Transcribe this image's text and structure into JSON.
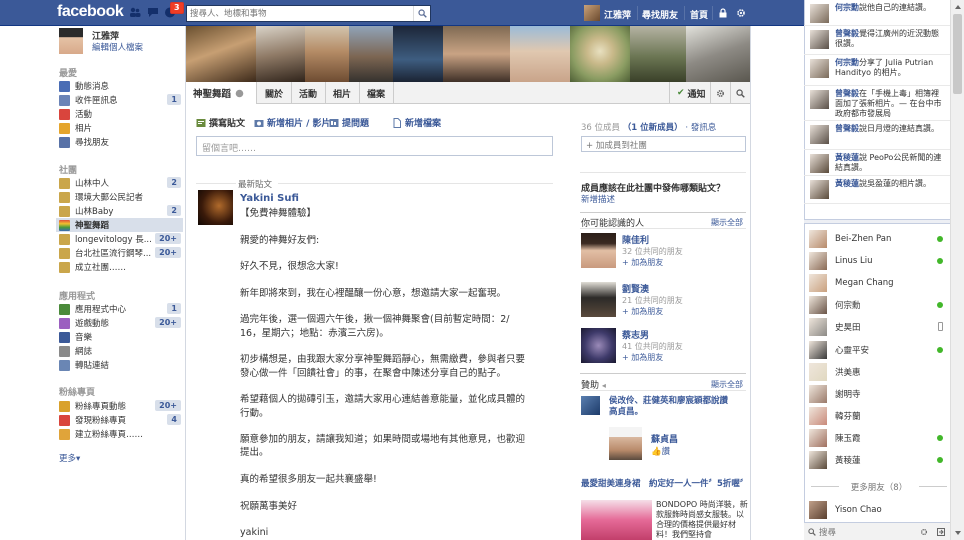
{
  "topbar": {
    "logo": "facebook",
    "notification_count": "3",
    "search_placeholder": "搜尋人、地標和事物",
    "user_name": "江雅萍",
    "find_friends": "尋找朋友",
    "home": "首頁"
  },
  "left_nav": {
    "profile_name": "江雅萍",
    "edit_profile": "編輯個人檔案",
    "favorites_heading": "最愛",
    "favorites": [
      {
        "label": "動態消息",
        "count": "",
        "icon": "news-feed-icon",
        "color": "#4a6db5"
      },
      {
        "label": "收件匣訊息",
        "count": "1",
        "icon": "messages-icon",
        "color": "#6b84b7"
      },
      {
        "label": "活動",
        "count": "",
        "icon": "events-icon",
        "color": "#d9453d"
      },
      {
        "label": "相片",
        "count": "",
        "icon": "photos-icon",
        "color": "#e5a52c"
      },
      {
        "label": "尋找朋友",
        "count": "",
        "icon": "find-friends-icon",
        "color": "#5872a7"
      }
    ],
    "groups_heading": "社團",
    "groups": [
      {
        "label": "山林中人",
        "count": "2",
        "icon": "group-icon",
        "color": "#caa64b"
      },
      {
        "label": "環境大郵公民記者",
        "count": "",
        "icon": "group-icon",
        "color": "#caa64b"
      },
      {
        "label": "山林Baby",
        "count": "2",
        "icon": "group-icon",
        "color": "#caa64b"
      },
      {
        "label": "神聖舞蹈",
        "count": "",
        "icon": "rainbow-group-icon",
        "color": "#e0503a"
      },
      {
        "label": "longevitology 長...",
        "count": "20+",
        "icon": "group-icon",
        "color": "#caa64b"
      },
      {
        "label": "台北社區流行鋼琴...",
        "count": "20+",
        "icon": "group-icon",
        "color": "#caa64b"
      },
      {
        "label": "成立社團……",
        "count": "",
        "icon": "create-group-icon",
        "color": "#caa64b"
      }
    ],
    "apps_heading": "應用程式",
    "apps": [
      {
        "label": "應用程式中心",
        "count": "1",
        "icon": "app-center-icon",
        "color": "#4a8a3a"
      },
      {
        "label": "遊戲動態",
        "count": "20+",
        "icon": "games-icon",
        "color": "#9b5fc0"
      },
      {
        "label": "音樂",
        "count": "",
        "icon": "music-icon",
        "color": "#3b5998"
      },
      {
        "label": "網誌",
        "count": "",
        "icon": "notes-icon",
        "color": "#8a8a8a"
      },
      {
        "label": "轉貼連結",
        "count": "",
        "icon": "links-icon",
        "color": "#6a86b4"
      }
    ],
    "pages_heading": "粉絲專頁",
    "pages": [
      {
        "label": "粉絲專頁動態",
        "count": "20+",
        "icon": "pages-feed-icon",
        "color": "#d9a12b"
      },
      {
        "label": "發現粉絲專頁",
        "count": "4",
        "icon": "discover-pages-icon",
        "color": "#d9453d"
      },
      {
        "label": "建立粉絲專頁……",
        "count": "",
        "icon": "create-page-icon",
        "color": "#e0a43a"
      }
    ],
    "more": "更多▾"
  },
  "group": {
    "name": "神聖舞蹈",
    "tabs": [
      "關於",
      "活動",
      "相片",
      "檔案"
    ],
    "notify": "通知"
  },
  "composer": {
    "tabs": [
      "撰寫貼文",
      "新增相片 / 影片",
      "提問題",
      "新增檔案"
    ],
    "placeholder": "留個言吧……"
  },
  "feed": {
    "label": "最新貼文",
    "author": "Yakini Sufi",
    "lines": [
      "【免費神舞體驗】",
      "",
      "親愛的神舞好友們:",
      "",
      "好久不見，很想念大家!",
      "",
      "新年即將來到，我在心裡醞釀一份心意，想邀請大家一起奮現。",
      "",
      "過完年後，選一個週六午後，揪一個神舞聚會(目前暫定時間：2/",
      "16，星期六；地點：赤濱三六房)。",
      "",
      "初步構想是，由我跟大家分享神聖舞蹈靜心，無需繳費，參與者只要",
      "發心做一件「回饋社會」的事，在聚會中陳述分享自己的點子。",
      "",
      "希望藉個人的拋磚引玉，邀請大家用心連結善意能量，並化成具體的",
      "行動。",
      "",
      "願意參加的朋友，請讓我知道；如果時間或場地有其他意見，也歡迎",
      "提出。",
      "",
      "真的希望很多朋友一起共襄盛舉!",
      "",
      "祝願萬事美好",
      "",
      "yakini"
    ]
  },
  "right_col": {
    "members": "36 位成員",
    "new_members": "（1 位新成員）",
    "invite": "· 發訊息",
    "add_people": "+ 加成員到社團",
    "question": "成員應該在此社團中發佈哪類貼文？",
    "add_desc": "新增描述",
    "pymk_heading": "你可能認識的人",
    "see_all": "顯示全部",
    "people": [
      {
        "name": "陳佳利",
        "mutual": "32 位共同的朋友",
        "add": "加為朋友"
      },
      {
        "name": "劉賢澳",
        "mutual": "21 位共同的朋友",
        "add": "加為朋友"
      },
      {
        "name": "蔡志男",
        "mutual": "41 位共同的朋友",
        "add": "加為朋友"
      }
    ],
    "sponsored_heading": "贊助",
    "sponsored_see_all": "顯示全部",
    "sponsor_line1": "侯改伶、莊健英和廖宸穎都說讚",
    "sponsor_line2": "高貞昌。",
    "sponsor_name": "蘇貞昌",
    "sponsor_like": "讚",
    "ad_title": "最愛甜美連身裙　約定好一人一件〞5折喔〞",
    "ad_text": "BONDOPO 時尚洋裝，新款服飾時尚感女服裝。以合理的價格提供最好材料！我們堅持會"
  },
  "ticker": [
    {
      "name": "何宗勳",
      "text": "說他自己的連結讚。"
    },
    {
      "name": "曾聲毅",
      "text": "覺得江廣州的近況動態很讚。"
    },
    {
      "name": "何宗勳",
      "text": "分享了 Julia Putrian Handityo 的相片。"
    },
    {
      "name": "曾聲毅",
      "text": "在「手機上毒」相簿裡面加了張新相片。— 在台中市政府都市發展局"
    },
    {
      "name": "曾聲毅",
      "text": "說日月燈的連結真讚。"
    },
    {
      "name": "黃稜蓮",
      "text": "說 PeoPo公民新聞的連結真讚。"
    },
    {
      "name": "黃稜蓮",
      "text": "說吳盈蓮的相片讚。"
    }
  ],
  "chat": {
    "friends": [
      {
        "name": "Bei-Zhen Pan",
        "status": "online"
      },
      {
        "name": "Linus Liu",
        "status": "online"
      },
      {
        "name": "Megan Chang",
        "status": "none"
      },
      {
        "name": "何宗勳",
        "status": "online"
      },
      {
        "name": "史昊田",
        "status": "mobile"
      },
      {
        "name": "心靈平安",
        "status": "online"
      },
      {
        "name": "洪美惠",
        "status": "none"
      },
      {
        "name": "謝明寺",
        "status": "none"
      },
      {
        "name": "韓芬蘭",
        "status": "none"
      },
      {
        "name": "陳玉霞",
        "status": "online"
      },
      {
        "name": "黃稜蓮",
        "status": "online"
      }
    ],
    "more_friends": "更多朋友（8）",
    "bottom_friend": "Yison Chao",
    "search_placeholder": "搜尋"
  }
}
